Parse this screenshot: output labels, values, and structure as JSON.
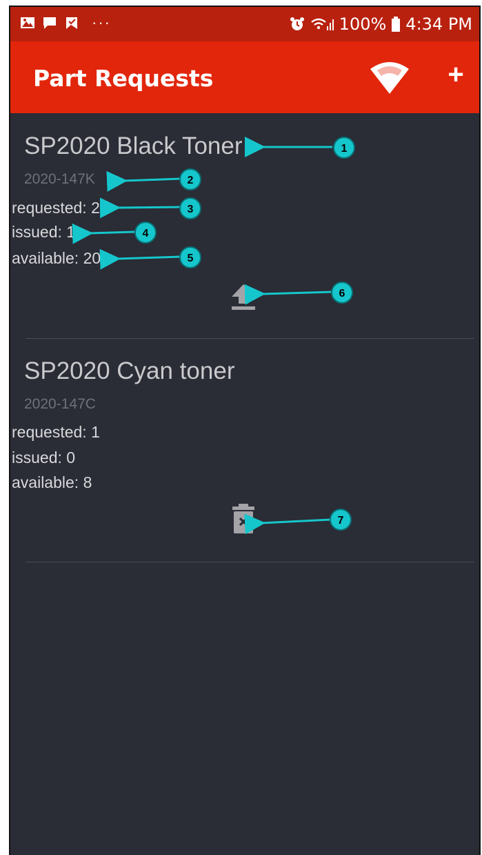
{
  "status_bar": {
    "battery": "100%",
    "time": "4:34 PM",
    "dots": "···"
  },
  "app_bar": {
    "title": "Part Requests",
    "add_label": "+"
  },
  "items": [
    {
      "name": "SP2020 Black Toner",
      "code": "2020-147K",
      "requested": "requested: 2",
      "issued": "issued: 1",
      "available": "available: 20",
      "action_icon": "upload-icon"
    },
    {
      "name": "SP2020 Cyan toner",
      "code": "2020-147C",
      "requested": "requested: 1",
      "issued": "issued: 0",
      "available": "available: 8",
      "action_icon": "delete-icon"
    }
  ],
  "callouts": [
    "1",
    "2",
    "3",
    "4",
    "5",
    "6",
    "7"
  ],
  "colors": {
    "status_bar": "#b9210f",
    "app_bar": "#e2260b",
    "background": "#2a2c36",
    "callout": "#15c7cc"
  }
}
